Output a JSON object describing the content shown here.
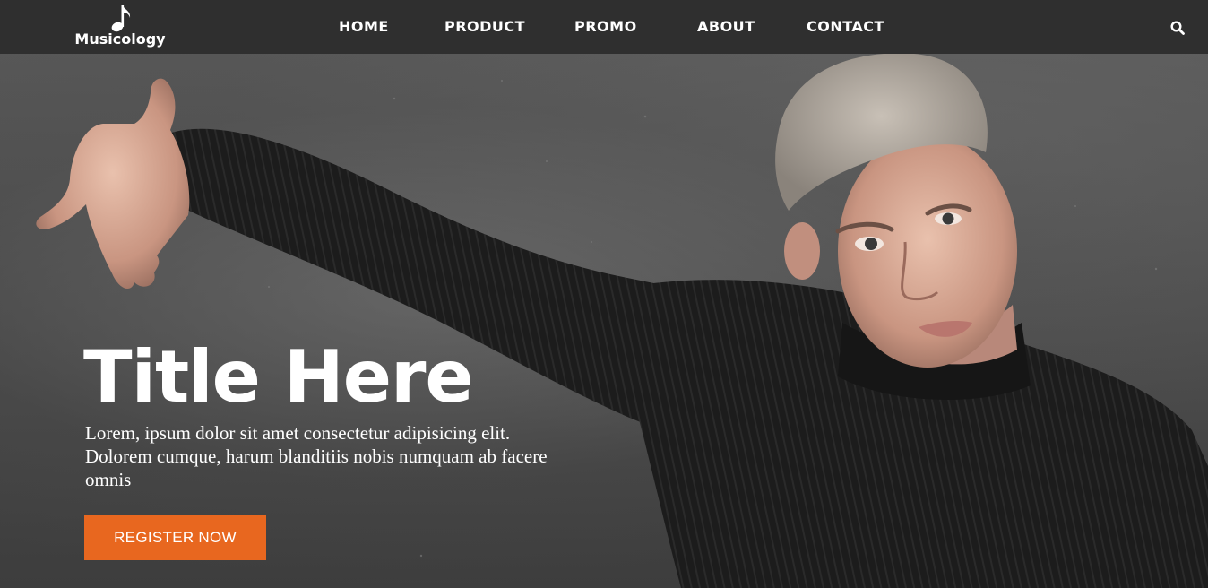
{
  "brand": {
    "name": "Musicology",
    "icon": "music-note-icon"
  },
  "nav": {
    "items": [
      {
        "label": "HOME"
      },
      {
        "label": "PRODUCT"
      },
      {
        "label": "PROMO"
      },
      {
        "label": "ABOUT"
      },
      {
        "label": "CONTACT"
      }
    ],
    "search_icon": "search-icon"
  },
  "hero": {
    "title": "Title Here",
    "text": "Lorem, ipsum dolor sit amet consectetur adipisicing elit. Dolorem cumque, harum blanditiis nobis numquam ab facere omnis",
    "cta_label": "REGISTER NOW"
  },
  "colors": {
    "navbar_bg": "#2f2f2f",
    "accent": "#e8671f",
    "text": "#ffffff"
  }
}
